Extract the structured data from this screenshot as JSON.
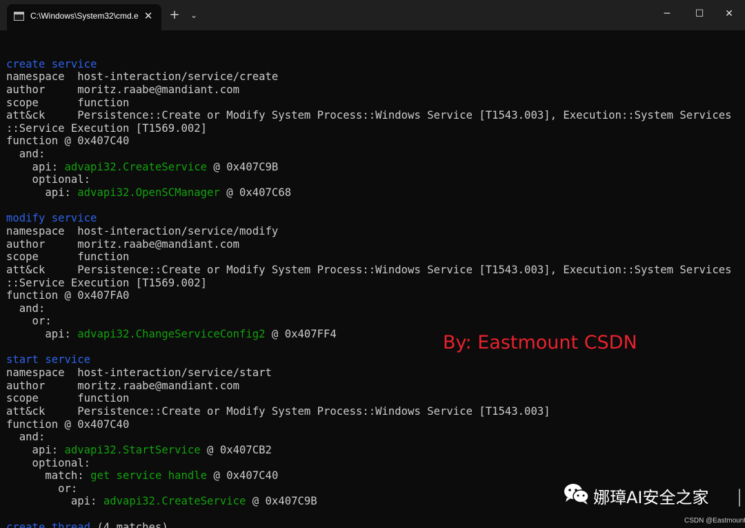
{
  "window": {
    "tab_title": "C:\\Windows\\System32\\cmd.e",
    "tab_close_glyph": "✕",
    "new_tab_glyph": "+",
    "dropdown_glyph": "⌄",
    "minimize_glyph": "─",
    "maximize_glyph": "☐",
    "close_glyph": "✕"
  },
  "colors": {
    "rule_name": "#2e62e8",
    "api_value": "#13a10e",
    "text": "#cccccc",
    "watermark": "#e8222f",
    "background": "#0c0c0c"
  },
  "terminal": {
    "lines": [
      [
        {
          "t": ""
        }
      ],
      [
        {
          "t": "create service",
          "c": "blue"
        }
      ],
      [
        {
          "t": "namespace  host-interaction/service/create"
        }
      ],
      [
        {
          "t": "author     moritz.raabe@mandiant.com"
        }
      ],
      [
        {
          "t": "scope      function"
        }
      ],
      [
        {
          "t": "att&ck     Persistence::Create or Modify System Process::Windows Service [T1543.003], Execution::System Services"
        }
      ],
      [
        {
          "t": "::Service Execution [T1569.002]"
        }
      ],
      [
        {
          "t": "function @ 0x407C40"
        }
      ],
      [
        {
          "t": "  and:"
        }
      ],
      [
        {
          "t": "    api: "
        },
        {
          "t": "advapi32.CreateService",
          "c": "green"
        },
        {
          "t": " @ 0x407C9B"
        }
      ],
      [
        {
          "t": "    optional:"
        }
      ],
      [
        {
          "t": "      api: "
        },
        {
          "t": "advapi32.OpenSCManager",
          "c": "green"
        },
        {
          "t": " @ 0x407C68"
        }
      ],
      [
        {
          "t": ""
        }
      ],
      [
        {
          "t": "modify service",
          "c": "blue"
        }
      ],
      [
        {
          "t": "namespace  host-interaction/service/modify"
        }
      ],
      [
        {
          "t": "author     moritz.raabe@mandiant.com"
        }
      ],
      [
        {
          "t": "scope      function"
        }
      ],
      [
        {
          "t": "att&ck     Persistence::Create or Modify System Process::Windows Service [T1543.003], Execution::System Services"
        }
      ],
      [
        {
          "t": "::Service Execution [T1569.002]"
        }
      ],
      [
        {
          "t": "function @ 0x407FA0"
        }
      ],
      [
        {
          "t": "  and:"
        }
      ],
      [
        {
          "t": "    or:"
        }
      ],
      [
        {
          "t": "      api: "
        },
        {
          "t": "advapi32.ChangeServiceConfig2",
          "c": "green"
        },
        {
          "t": " @ 0x407FF4"
        }
      ],
      [
        {
          "t": ""
        }
      ],
      [
        {
          "t": "start service",
          "c": "blue"
        }
      ],
      [
        {
          "t": "namespace  host-interaction/service/start"
        }
      ],
      [
        {
          "t": "author     moritz.raabe@mandiant.com"
        }
      ],
      [
        {
          "t": "scope      function"
        }
      ],
      [
        {
          "t": "att&ck     Persistence::Create or Modify System Process::Windows Service [T1543.003]"
        }
      ],
      [
        {
          "t": "function @ 0x407C40"
        }
      ],
      [
        {
          "t": "  and:"
        }
      ],
      [
        {
          "t": "    api: "
        },
        {
          "t": "advapi32.StartService",
          "c": "green"
        },
        {
          "t": " @ 0x407CB2"
        }
      ],
      [
        {
          "t": "    optional:"
        }
      ],
      [
        {
          "t": "      match: "
        },
        {
          "t": "get service handle",
          "c": "green"
        },
        {
          "t": " @ 0x407C40"
        }
      ],
      [
        {
          "t": "        or:"
        }
      ],
      [
        {
          "t": "          api: "
        },
        {
          "t": "advapi32.CreateService",
          "c": "green"
        },
        {
          "t": " @ 0x407C9B"
        }
      ],
      [
        {
          "t": ""
        }
      ],
      [
        {
          "t": "create thread",
          "c": "blue"
        },
        {
          "t": " (4 matches)"
        }
      ]
    ]
  },
  "overlay": {
    "watermark": "By: Eastmount CSDN",
    "brand": "娜璋AI安全之家",
    "credit": "CSDN @Eastmount",
    "brand_icon": "wechat-icon"
  }
}
